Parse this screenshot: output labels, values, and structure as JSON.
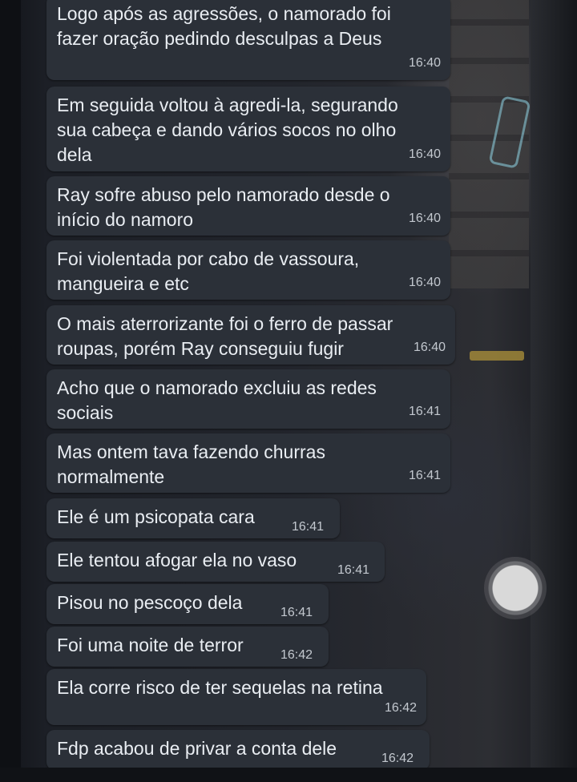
{
  "messages": [
    {
      "text": "Logo após as agressões, o namorado foi\nfazer oração pedindo desculpas a Deus",
      "time": "16:40"
    },
    {
      "text": "Em seguida voltou à agredi-la, segurando\nsua cabeça e dando vários socos no olho\ndela",
      "time": "16:40"
    },
    {
      "text": "Ray sofre abuso pelo namorado desde o\ninício do namoro",
      "time": "16:40"
    },
    {
      "text": "Foi violentada por cabo de vassoura,\nmangueira e etc",
      "time": "16:40"
    },
    {
      "text": "O mais aterrorizante foi o ferro de passar\nroupas, porém Ray conseguiu fugir",
      "time": "16:40"
    },
    {
      "text": "Acho que o namorado excluiu as redes\nsociais",
      "time": "16:41"
    },
    {
      "text": "Mas ontem tava fazendo churras\nnormalmente",
      "time": "16:41"
    },
    {
      "text": "Ele é um psicopata cara",
      "time": "16:41"
    },
    {
      "text": "Ele tentou afogar ela no vaso",
      "time": "16:41"
    },
    {
      "text": "Pisou no pescoço dela",
      "time": "16:41"
    },
    {
      "text": "Foi uma noite de terror",
      "time": "16:42"
    },
    {
      "text": "Ela corre risco de ter sequelas na retina",
      "time": "16:42"
    },
    {
      "text": "Fdp acabou de privar a conta dele",
      "time": "16:42"
    }
  ],
  "floating_button": {
    "icon": "circle-icon"
  },
  "colors": {
    "bubble": "#2b3038",
    "text": "#e9edf2",
    "time": "#c3c8cf"
  }
}
